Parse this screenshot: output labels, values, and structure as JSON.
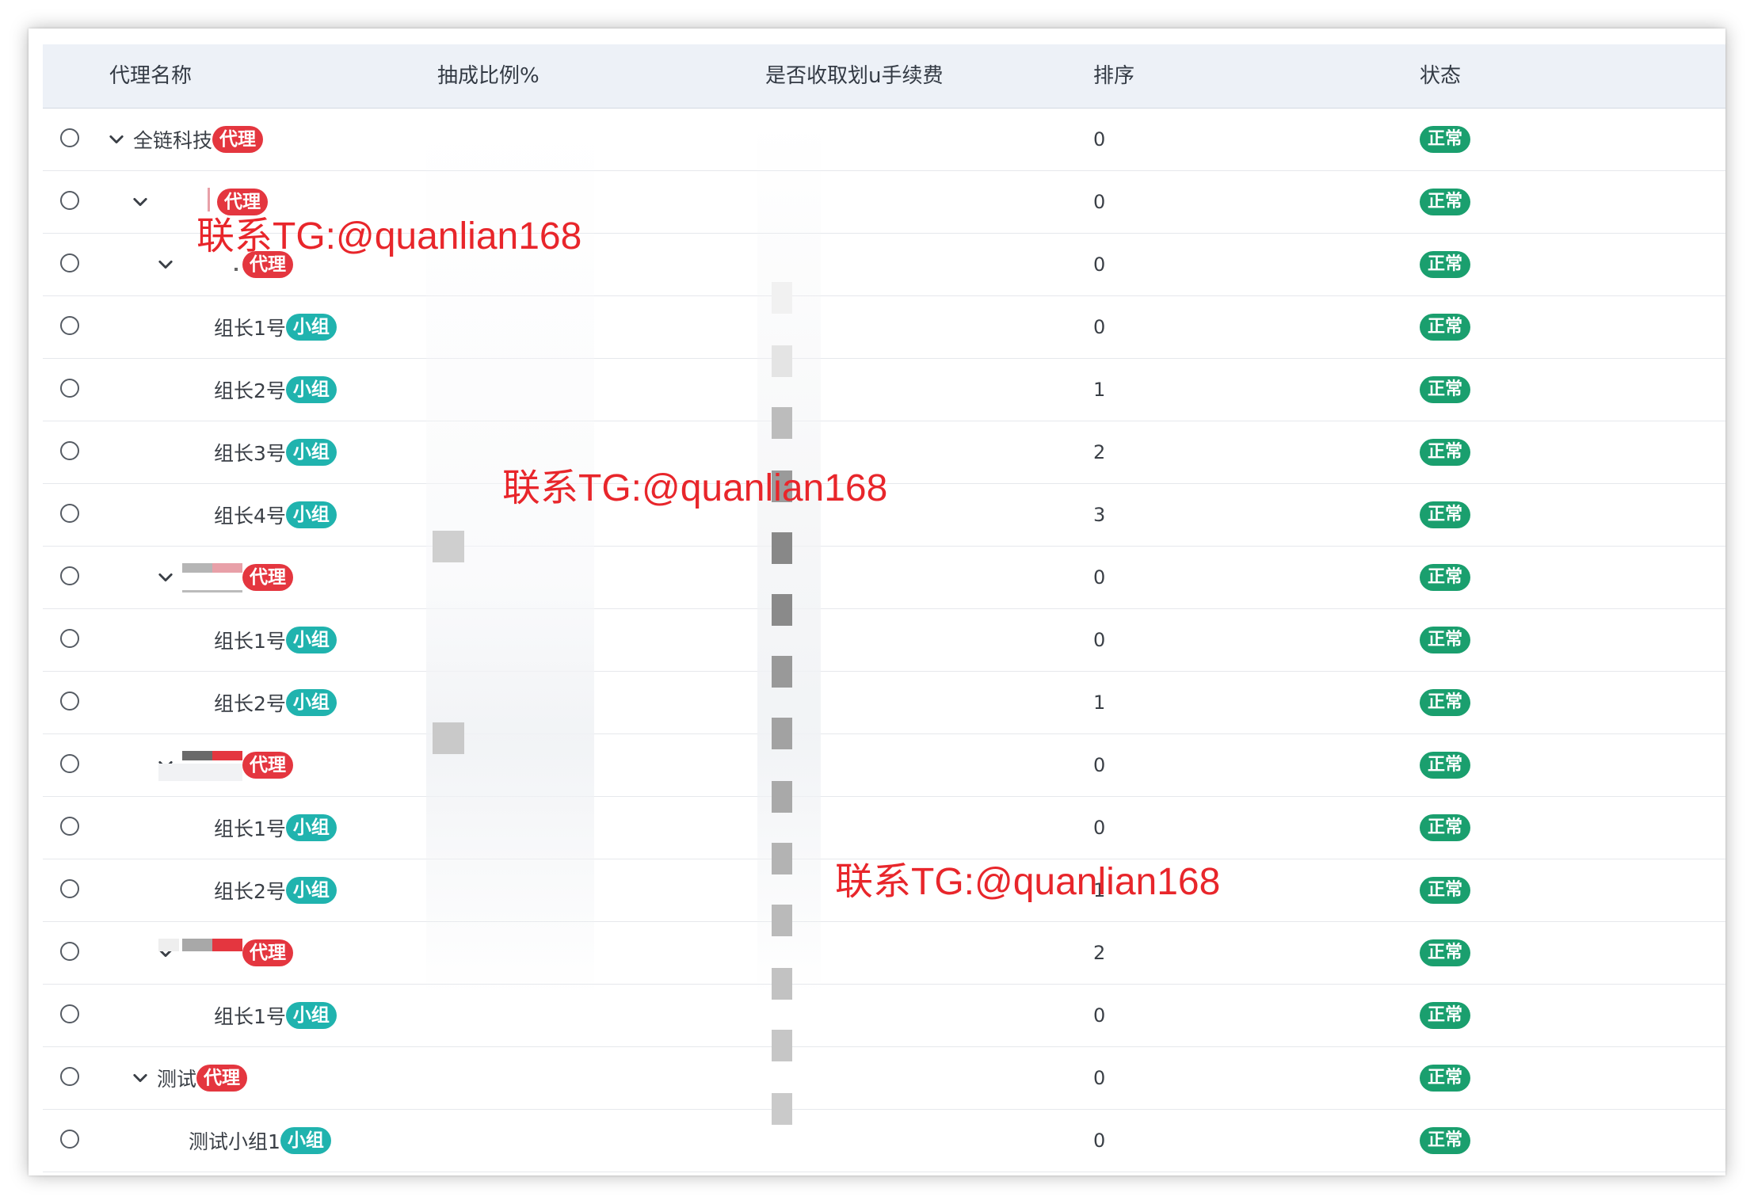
{
  "columns": {
    "name": "代理名称",
    "ratio": "抽成比例%",
    "fee": "是否收取划u手续费",
    "order": "排序",
    "status": "状态"
  },
  "badges": {
    "agent": "代理",
    "group": "小组",
    "status_normal": "正常"
  },
  "rows": [
    {
      "name": "全链科技",
      "type": "agent",
      "expanded": true,
      "order": "0",
      "status": "正常"
    },
    {
      "name": "",
      "type": "agent",
      "expanded": true,
      "order": "0",
      "status": "正常"
    },
    {
      "name": "",
      "type": "agent",
      "expanded": true,
      "order": "0",
      "status": "正常"
    },
    {
      "name": "组长1号",
      "type": "group",
      "expanded": false,
      "order": "0",
      "status": "正常"
    },
    {
      "name": "组长2号",
      "type": "group",
      "expanded": false,
      "order": "1",
      "status": "正常"
    },
    {
      "name": "组长3号",
      "type": "group",
      "expanded": false,
      "order": "2",
      "status": "正常"
    },
    {
      "name": "组长4号",
      "type": "group",
      "expanded": false,
      "order": "3",
      "status": "正常"
    },
    {
      "name": "",
      "type": "agent",
      "expanded": true,
      "order": "0",
      "status": "正常"
    },
    {
      "name": "组长1号",
      "type": "group",
      "expanded": false,
      "order": "0",
      "status": "正常"
    },
    {
      "name": "组长2号",
      "type": "group",
      "expanded": false,
      "order": "1",
      "status": "正常"
    },
    {
      "name": "",
      "type": "agent",
      "expanded": true,
      "order": "0",
      "status": "正常"
    },
    {
      "name": "组长1号",
      "type": "group",
      "expanded": false,
      "order": "0",
      "status": "正常"
    },
    {
      "name": "组长2号",
      "type": "group",
      "expanded": false,
      "order": "1",
      "status": "正常"
    },
    {
      "name": "",
      "type": "agent",
      "expanded": true,
      "order": "2",
      "status": "正常"
    },
    {
      "name": "组长1号",
      "type": "group",
      "expanded": false,
      "order": "0",
      "status": "正常"
    },
    {
      "name": "测试",
      "type": "agent",
      "expanded": true,
      "order": "0",
      "status": "正常"
    },
    {
      "name": "测试小组1",
      "type": "group",
      "expanded": false,
      "order": "0",
      "status": "正常"
    }
  ],
  "watermarks": [
    "联系TG:@quanlian168",
    "联系TG:@quanlian168",
    "联系TG:@quanlian168"
  ],
  "colors": {
    "agent_badge": "#e4363f",
    "group_badge": "#20b3ae",
    "status_badge": "#1a9f6e",
    "header_bg": "#edf1f7",
    "watermark": "#e8262b"
  },
  "icons": {
    "expand": "chevron-down-icon",
    "select": "radio-icon"
  }
}
